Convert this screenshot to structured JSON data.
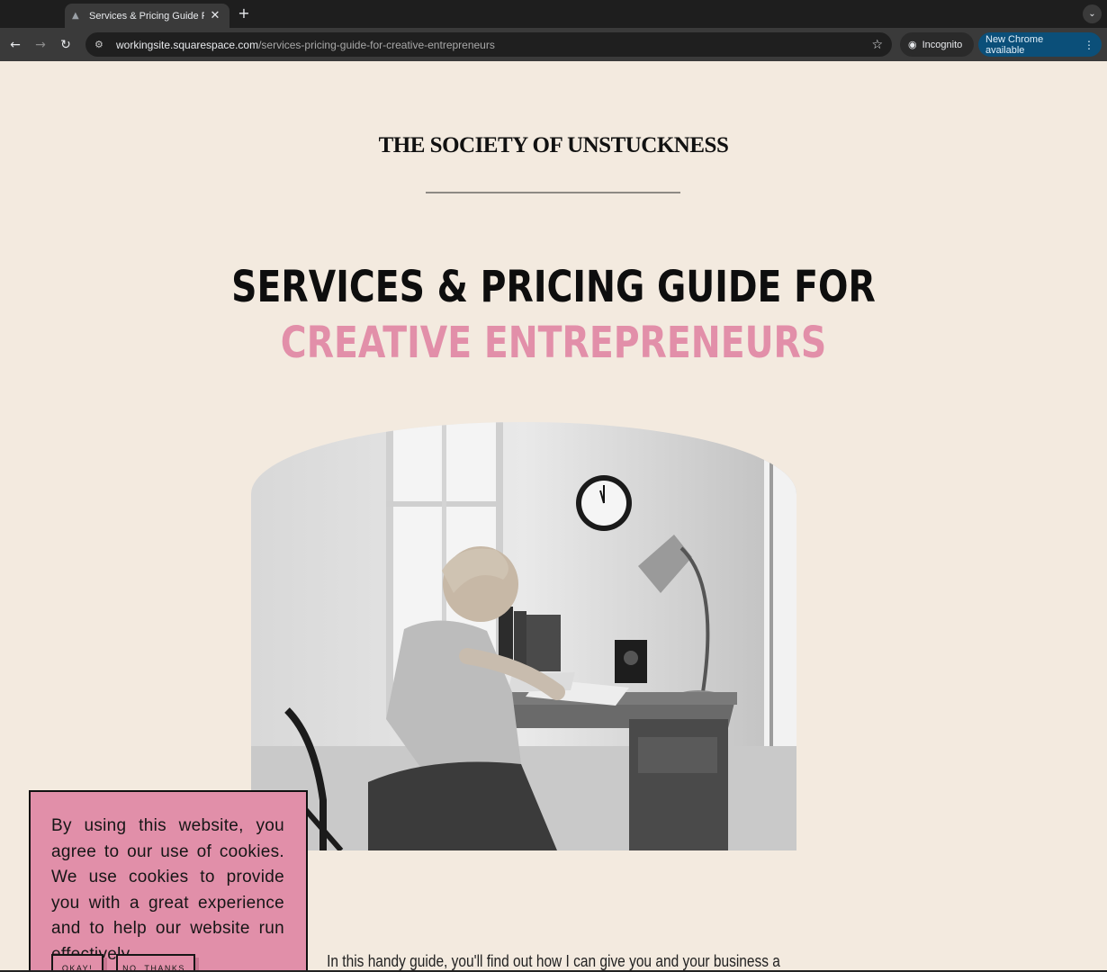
{
  "browser": {
    "tab_title": "Services & Pricing Guide For C",
    "url_host": "workingsite.squarespace.com",
    "url_path": "/services-pricing-guide-for-creative-entrepreneurs",
    "incognito_label": "Incognito",
    "update_label": "New Chrome available"
  },
  "site": {
    "title": "THE SOCIETY OF UNSTUCKNESS"
  },
  "hero": {
    "line1": "SERVICES & PRICING GUIDE FOR",
    "line2": "CREATIVE ENTREPRENEURS",
    "accent_color": "#e28fa9"
  },
  "intro": {
    "text": "In this handy guide, you'll find out how I can give you and your business a"
  },
  "cookie_banner": {
    "text": "By using this website, you agree to our use of cookies. We use cookies to provide you with a great experience and to help our website run effectively.",
    "okay_label": "OKAY!",
    "no_label": "NO, THANKS.",
    "background": "#e18fa9"
  },
  "icons": {
    "tab_favicon": "graduation-cap-icon",
    "scroll_top": "chevron-up-icon"
  }
}
